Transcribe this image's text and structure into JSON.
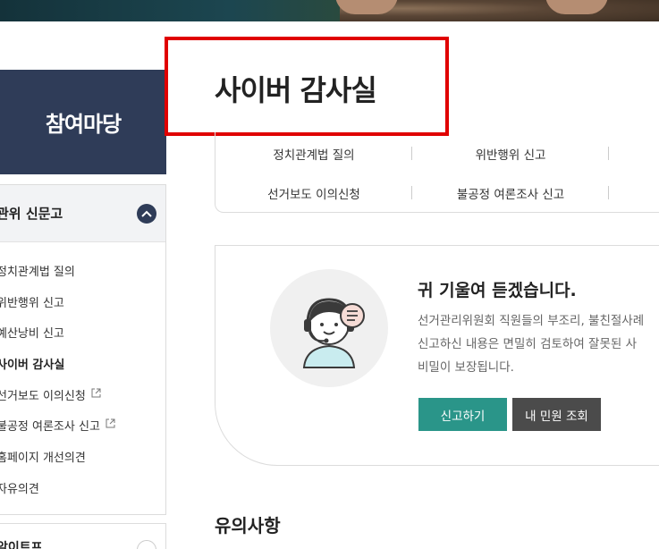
{
  "sidebar": {
    "heading": "참여마당",
    "group_title": "관위 신문고",
    "items": [
      {
        "label": "정치관계법 질의",
        "external": false,
        "active": false
      },
      {
        "label": "위반행위 신고",
        "external": false,
        "active": false
      },
      {
        "label": "예산낭비 신고",
        "external": false,
        "active": false
      },
      {
        "label": "사이버 감사실",
        "external": false,
        "active": true
      },
      {
        "label": "선거보도 이의신청",
        "external": true,
        "active": false
      },
      {
        "label": "불공정 여론조사 신고",
        "external": true,
        "active": false
      },
      {
        "label": "홈페이지 개선의견",
        "external": false,
        "active": false
      },
      {
        "label": "자유의견",
        "external": false,
        "active": false
      }
    ],
    "group2_title": "알이트프"
  },
  "main": {
    "title": "사이버 감사실",
    "tabs": [
      "정치관계법 질의",
      "위반행위 신고",
      "선거보도 이의신청",
      "불공정 여론조사 신고"
    ],
    "card": {
      "heading": "귀 기울여 듣겠습니다.",
      "desc": [
        "선거관리위원회 직원들의 부조리, 불친절사례",
        "신고하신 내용은 면밀히 검토하여 잘못된 사",
        "비밀이 보장됩니다."
      ],
      "report_button": "신고하기",
      "lookup_button": "내 민원 조회"
    },
    "notes_title": "유의사항"
  },
  "colors": {
    "sidebar_head": "#2f3c58",
    "report_button": "#2a9589",
    "lookup_button": "#4b4b4b",
    "highlight_box": "#e00000"
  }
}
